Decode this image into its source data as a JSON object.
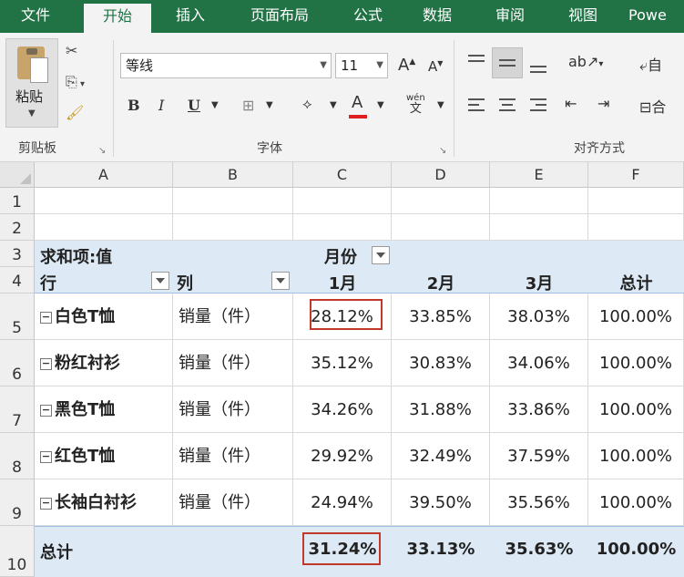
{
  "tabs": [
    "文件",
    "开始",
    "插入",
    "页面布局",
    "公式",
    "数据",
    "审阅",
    "视图",
    "Powe"
  ],
  "ribbon": {
    "paste_label": "粘贴",
    "clipboard_group": "剪贴板",
    "font_group": "字体",
    "align_group": "对齐方式",
    "font_name": "等线",
    "font_size": "11",
    "bold": "B",
    "italic": "I",
    "underline": "U",
    "grow_font": "A",
    "shrink_font": "A",
    "font_color_letter": "A",
    "phonetic_top": "wén",
    "phonetic_bottom": "文",
    "wrap_partial": "自",
    "merge_partial": "合"
  },
  "columns": [
    "A",
    "B",
    "C",
    "D",
    "E",
    "F"
  ],
  "rows": [
    "1",
    "2",
    "3",
    "4",
    "5",
    "6",
    "7",
    "8",
    "9",
    "10"
  ],
  "pivot": {
    "values_label": "求和项:值",
    "col_field": "月份",
    "row_label": "行",
    "col_label": "列",
    "months": [
      "1月",
      "2月",
      "3月",
      "总计"
    ],
    "items": [
      {
        "name": "白色T恤",
        "measure": "销量（件）",
        "values": [
          "28.12%",
          "33.85%",
          "38.03%",
          "100.00%"
        ]
      },
      {
        "name": "粉红衬衫",
        "measure": "销量（件）",
        "values": [
          "35.12%",
          "30.83%",
          "34.06%",
          "100.00%"
        ]
      },
      {
        "name": "黑色T恤",
        "measure": "销量（件）",
        "values": [
          "34.26%",
          "31.88%",
          "33.86%",
          "100.00%"
        ]
      },
      {
        "name": "红色T恤",
        "measure": "销量（件）",
        "values": [
          "29.92%",
          "32.49%",
          "37.59%",
          "100.00%"
        ]
      },
      {
        "name": "长袖白衬衫",
        "measure": "销量（件）",
        "values": [
          "24.94%",
          "39.50%",
          "35.56%",
          "100.00%"
        ]
      }
    ],
    "grand_total_label": "总计",
    "grand_totals": [
      "31.24%",
      "33.13%",
      "35.63%",
      "100.00%"
    ]
  },
  "colors": {
    "excel_green": "#217346",
    "pivot_band": "#dde9f5",
    "highlight_red": "#c0392b"
  }
}
